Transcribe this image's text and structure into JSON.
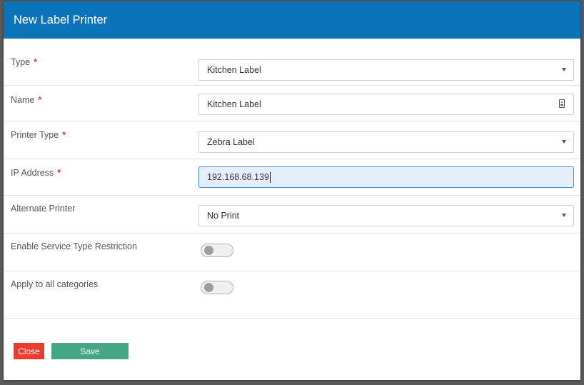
{
  "dialog": {
    "title": "New Label Printer"
  },
  "required_marker": "*",
  "fields": {
    "type": {
      "label": "Type",
      "value": "Kitchen Label"
    },
    "name": {
      "label": "Name",
      "value": "Kitchen Label"
    },
    "printer_type": {
      "label": "Printer Type",
      "value": "Zebra Label"
    },
    "ip_address": {
      "label": "IP Address",
      "value": "192.168.68.139"
    },
    "alternate_printer": {
      "label": "Alternate Printer",
      "value": "No Print"
    },
    "enable_service_type_restriction": {
      "label": "Enable Service Type Restriction",
      "enabled": false
    },
    "apply_to_all_categories": {
      "label": "Apply to all categories",
      "enabled": false
    }
  },
  "buttons": {
    "close": "Close",
    "save": "Save"
  },
  "colors": {
    "header": "#0a73b9",
    "required": "#e53935",
    "close_button": "#ef3b2d",
    "save_button": "#45a882",
    "focused_field": "#e4effb"
  },
  "icons": {
    "dropdown": "chevron-down-icon",
    "name_field": "contact-card-icon"
  }
}
